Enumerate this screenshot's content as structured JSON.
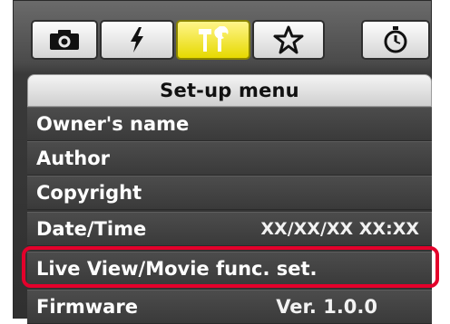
{
  "tabs": [
    {
      "name": "shooting",
      "icon": "camera-icon",
      "active": false
    },
    {
      "name": "flash",
      "icon": "flash-icon",
      "active": false
    },
    {
      "name": "setup",
      "icon": "tools-icon",
      "active": true
    },
    {
      "name": "my-menu",
      "icon": "star-icon",
      "active": false
    },
    {
      "name": "timer",
      "icon": "stopwatch-icon",
      "active": false
    }
  ],
  "colors": {
    "active_tab": "#f0e200",
    "highlight_border": "#e4002b",
    "menu_bg": "#3f3f3f"
  },
  "menu": {
    "title": "Set-up menu",
    "items": [
      {
        "label": "Owner's name",
        "value": ""
      },
      {
        "label": "Author",
        "value": ""
      },
      {
        "label": "Copyright",
        "value": ""
      },
      {
        "label": "Date/Time",
        "value": "XX/XX/XX XX:XX"
      },
      {
        "label": "Live View/Movie func. set.",
        "value": "",
        "highlighted": true
      },
      {
        "label": "Firmware",
        "value": "Ver. 1.0.0"
      }
    ]
  }
}
